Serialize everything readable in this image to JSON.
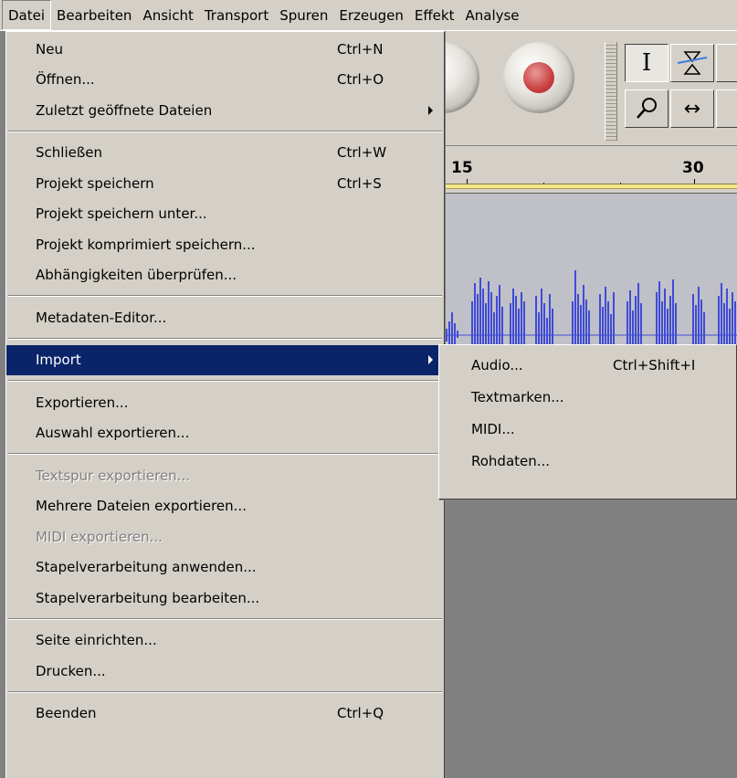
{
  "menubar": {
    "items": [
      {
        "label": "Datei"
      },
      {
        "label": "Bearbeiten"
      },
      {
        "label": "Ansicht"
      },
      {
        "label": "Transport"
      },
      {
        "label": "Spuren"
      },
      {
        "label": "Erzeugen"
      },
      {
        "label": "Effekt"
      },
      {
        "label": "Analyse"
      }
    ]
  },
  "file_menu": {
    "items": [
      {
        "label": "Neu",
        "shortcut": "Ctrl+N"
      },
      {
        "label": "Öffnen...",
        "shortcut": "Ctrl+O"
      },
      {
        "label": "Zuletzt geöffnete Dateien"
      },
      {
        "label": "Schließen",
        "shortcut": "Ctrl+W"
      },
      {
        "label": "Projekt speichern",
        "shortcut": "Ctrl+S"
      },
      {
        "label": "Projekt speichern unter..."
      },
      {
        "label": "Projekt komprimiert speichern..."
      },
      {
        "label": "Abhängigkeiten überprüfen..."
      },
      {
        "label": "Metadaten-Editor..."
      },
      {
        "label": "Import"
      },
      {
        "label": "Exportieren..."
      },
      {
        "label": "Auswahl exportieren..."
      },
      {
        "label": "Textspur exportieren...",
        "disabled": true
      },
      {
        "label": "Mehrere Dateien exportieren..."
      },
      {
        "label": "MIDI exportieren...",
        "disabled": true
      },
      {
        "label": "Stapelverarbeitung anwenden..."
      },
      {
        "label": "Stapelverarbeitung bearbeiten..."
      },
      {
        "label": "Seite einrichten..."
      },
      {
        "label": "Drucken..."
      },
      {
        "label": "Beenden",
        "shortcut": "Ctrl+Q"
      }
    ]
  },
  "import_submenu": {
    "items": [
      {
        "label": "Audio...",
        "shortcut": "Ctrl+Shift+I"
      },
      {
        "label": "Textmarken..."
      },
      {
        "label": "MIDI..."
      },
      {
        "label": "Rohdaten..."
      }
    ]
  },
  "toolbar": {
    "select_tool_glyph": "I",
    "timeshift_tool_glyph": "↔"
  },
  "ruler": {
    "labels": [
      "15",
      "30"
    ]
  },
  "colors": {
    "menu_bg": "#d4d0c8",
    "highlight": "#0a246a",
    "waveform": "#3f4bd6",
    "disabled_text": "#808080"
  }
}
